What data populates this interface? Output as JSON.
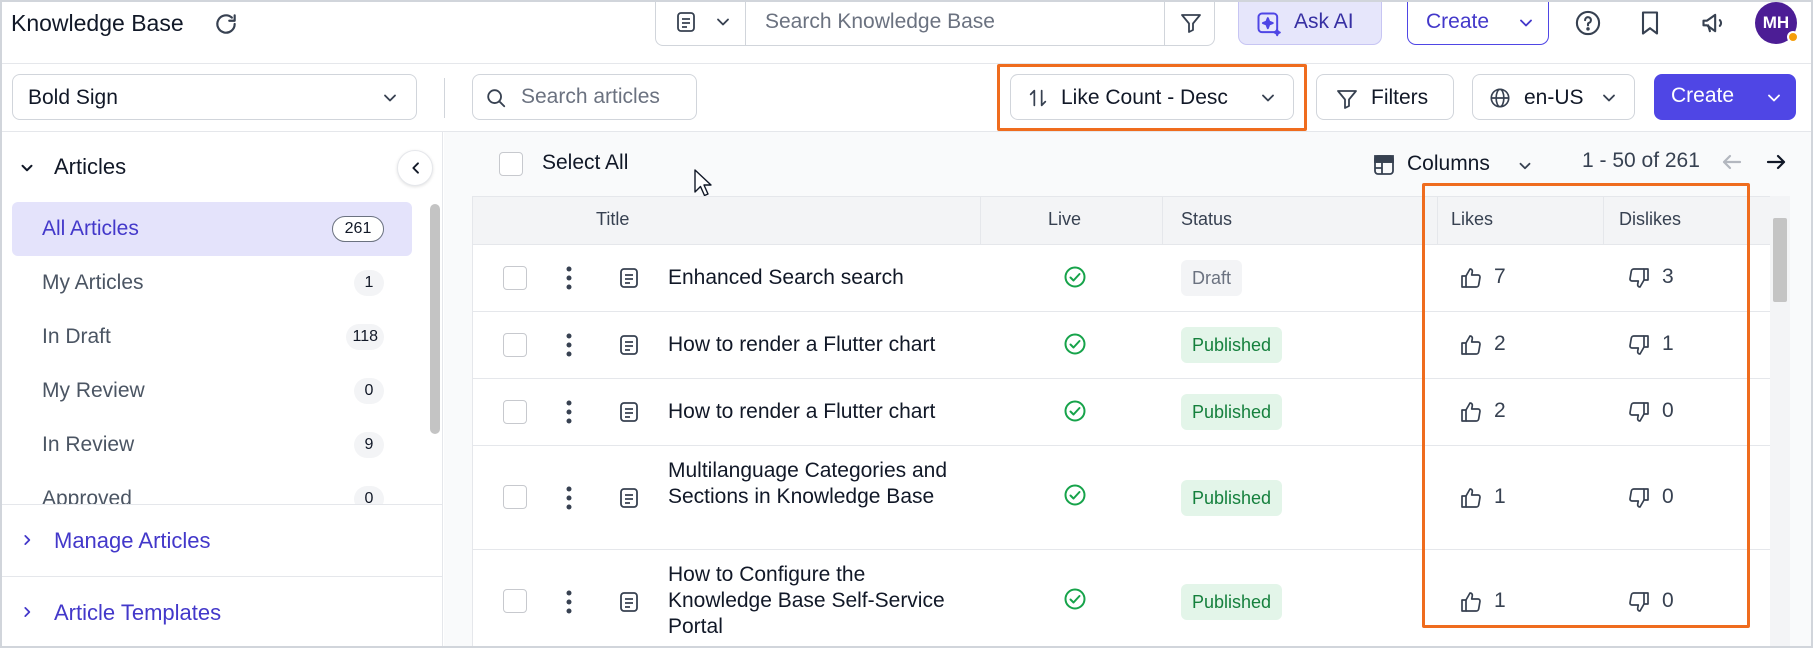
{
  "app": {
    "title": "Knowledge Base"
  },
  "header": {
    "search_placeholder": "Search Knowledge Base",
    "ask_ai_label": "Ask AI",
    "create_label": "Create",
    "avatar_initials": "MH"
  },
  "toolbar": {
    "knowledge_base": "Bold Sign",
    "search_placeholder": "Search articles",
    "sort_label": "Like Count - Desc",
    "filters_label": "Filters",
    "language": "en-US",
    "create_label": "Create"
  },
  "sidebar": {
    "section_title": "Articles",
    "items": [
      {
        "label": "All Articles",
        "count": "261",
        "active": true
      },
      {
        "label": "My Articles",
        "count": "1"
      },
      {
        "label": "In Draft",
        "count": "118"
      },
      {
        "label": "My Review",
        "count": "0"
      },
      {
        "label": "In Review",
        "count": "9"
      },
      {
        "label": "Approved",
        "count": "0"
      }
    ],
    "manage_articles": "Manage Articles",
    "article_templates": "Article Templates"
  },
  "list": {
    "select_all": "Select All",
    "columns_label": "Columns",
    "pagination": "1 - 50 of 261",
    "columns": {
      "title": "Title",
      "live": "Live",
      "status": "Status",
      "likes": "Likes",
      "dislikes": "Dislikes"
    },
    "rows": [
      {
        "title": "Enhanced Search search",
        "status": "Draft",
        "likes": "7",
        "dislikes": "3"
      },
      {
        "title": "How to render a Flutter chart",
        "status": "Published",
        "likes": "2",
        "dislikes": "1"
      },
      {
        "title": "How to render a Flutter chart",
        "status": "Published",
        "likes": "2",
        "dislikes": "0"
      },
      {
        "title": "Multilanguage Categories and Sections in Knowledge Base",
        "status": "Published",
        "likes": "1",
        "dislikes": "0"
      },
      {
        "title": "How to Configure the Knowledge Base Self-Service Portal",
        "status": "Published",
        "likes": "1",
        "dislikes": "0"
      }
    ]
  },
  "colors": {
    "accent": "#4f46e5",
    "highlight": "#ef6c1e",
    "published_text": "#15803d",
    "live_check": "#16a34a"
  }
}
